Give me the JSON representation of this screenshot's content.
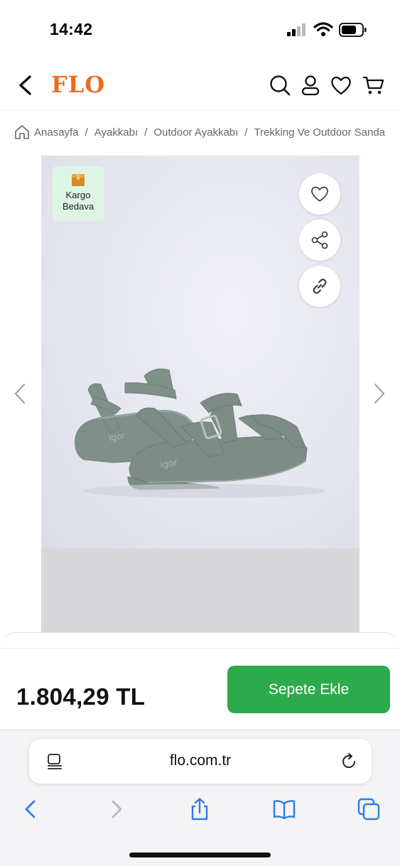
{
  "status_bar": {
    "time": "14:42",
    "icons": [
      "signal-icon",
      "wifi-icon",
      "battery-icon"
    ]
  },
  "header": {
    "logo": "FLO",
    "icons": [
      "back-icon",
      "search-icon",
      "user-icon",
      "heart-icon",
      "cart-icon"
    ],
    "brand_color": "#f26a21"
  },
  "breadcrumb": {
    "items": [
      "Anasayfa",
      "Ayakkabı",
      "Outdoor Ayakkabı",
      "Trekking Ve Outdoor Sandalet"
    ],
    "separator": "/"
  },
  "gallery": {
    "badge_line1": "Kargo",
    "badge_line2": "Bedava",
    "actions": [
      "heart-icon",
      "share-icon",
      "link-icon"
    ],
    "product_imprint": "igor"
  },
  "purchase": {
    "price": "1.804,29 TL",
    "add_to_cart_label": "Sepete Ekle",
    "accent_color": "#2daa4c"
  },
  "browser": {
    "url": "flo.com.tr",
    "toolbar_icons": [
      "reader-icon",
      "reload-icon",
      "back-icon",
      "forward-icon",
      "share-icon",
      "bookmarks-icon",
      "tabs-icon"
    ],
    "tint_color": "#2f7de1"
  }
}
